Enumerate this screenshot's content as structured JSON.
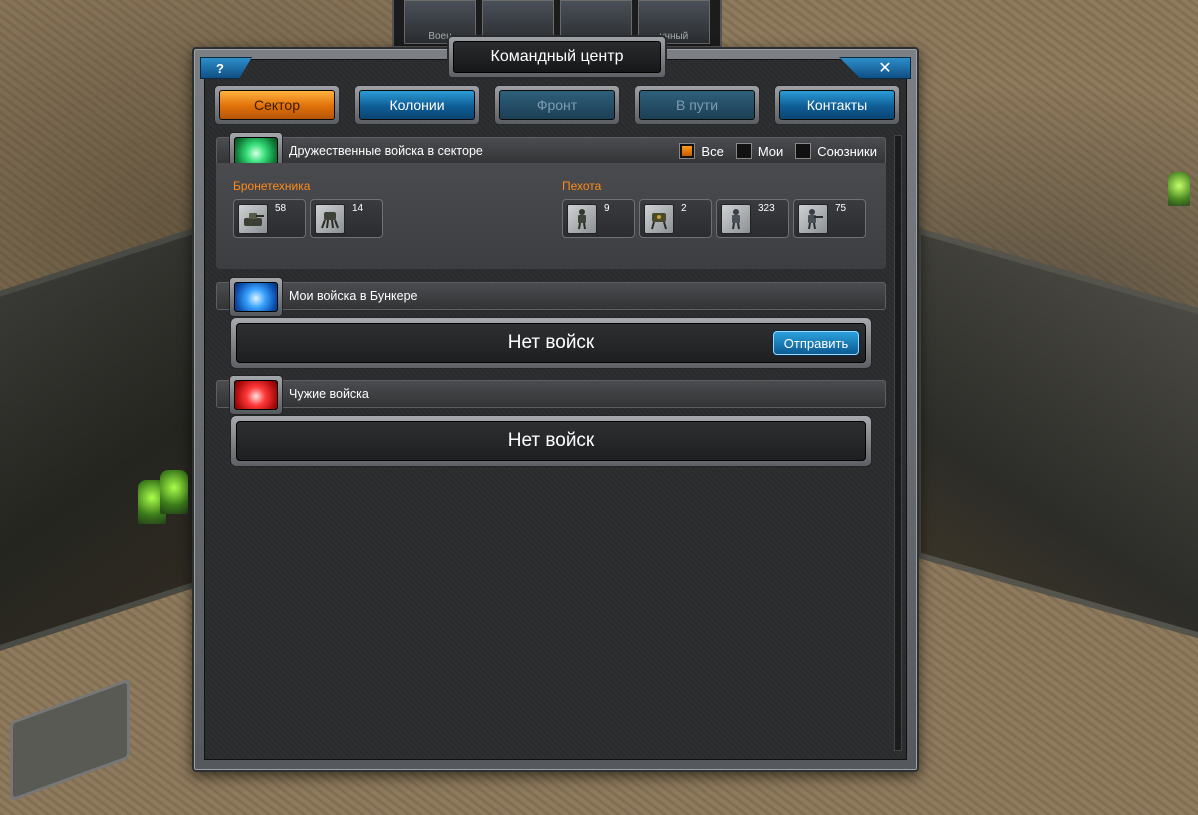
{
  "window": {
    "title": "Командный центр",
    "help_label": "?",
    "close_label": "✕"
  },
  "portraits": [
    {
      "label": "Воен"
    },
    {
      "label": ""
    },
    {
      "label": ""
    },
    {
      "label": "учный"
    }
  ],
  "tabs": [
    {
      "label": "Сектор",
      "state": "active"
    },
    {
      "label": "Колонии",
      "state": "normal"
    },
    {
      "label": "Фронт",
      "state": "disabled"
    },
    {
      "label": "В пути",
      "state": "disabled"
    },
    {
      "label": "Контакты",
      "state": "normal"
    }
  ],
  "friendly": {
    "title": "Дружественные войска в секторе",
    "gem": "green-gem-icon",
    "filters": [
      {
        "label": "Все",
        "checked": true
      },
      {
        "label": "Мои",
        "checked": false
      },
      {
        "label": "Союзники",
        "checked": false
      }
    ],
    "groups": [
      {
        "label": "Бронетехника",
        "units": [
          {
            "icon": "tank-icon",
            "count": "58"
          },
          {
            "icon": "walker-icon",
            "count": "14"
          }
        ]
      },
      {
        "label": "Пехота",
        "units": [
          {
            "icon": "soldier-icon",
            "count": "9"
          },
          {
            "icon": "mech-icon",
            "count": "2"
          },
          {
            "icon": "trooper-icon",
            "count": "323"
          },
          {
            "icon": "gunner-icon",
            "count": "75"
          }
        ]
      }
    ]
  },
  "bunker": {
    "title": "Мои войска в Бункере",
    "gem": "blue-gem-icon",
    "empty_text": "Нет войск",
    "send_label": "Отправить"
  },
  "foreign": {
    "title": "Чужие войска",
    "gem": "red-gem-icon",
    "empty_text": "Нет войск"
  },
  "colors": {
    "accent_orange": "#e0700a",
    "tab_blue": "#0f5d95",
    "group_label": "#ff8a1a"
  }
}
